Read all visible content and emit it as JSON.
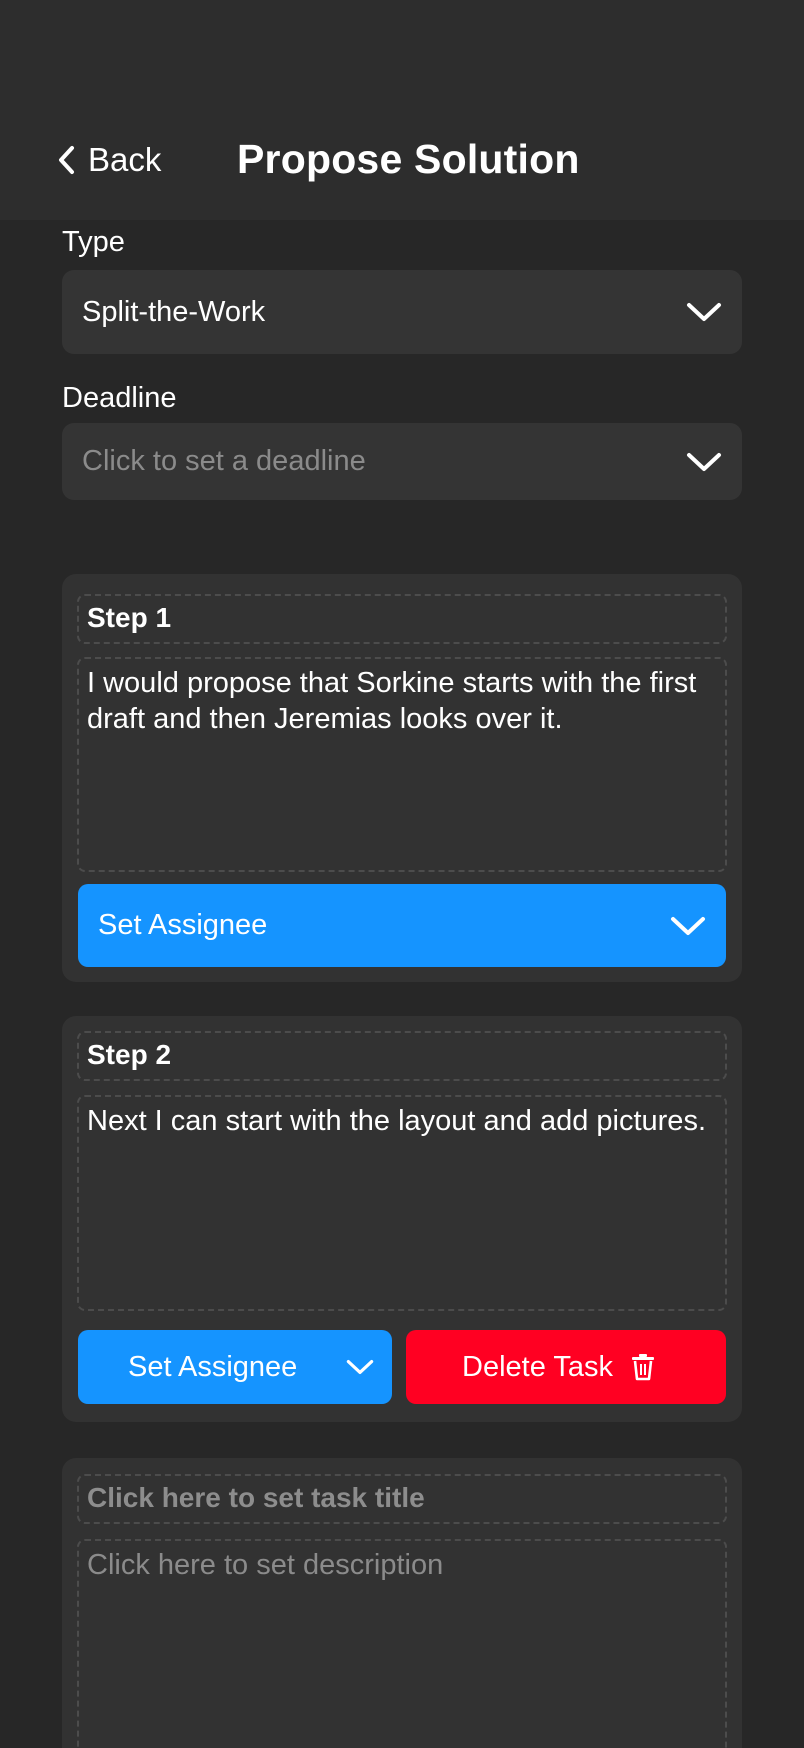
{
  "header": {
    "back_label": "Back",
    "title": "Propose Solution"
  },
  "form": {
    "type_label": "Type",
    "type_value": "Split-the-Work",
    "deadline_label": "Deadline",
    "deadline_placeholder": "Click to set a deadline"
  },
  "steps": [
    {
      "title": "Step 1",
      "description": "I would propose that Sorkine starts with the first draft and then Jeremias looks over it.",
      "assignee_label": "Set Assignee"
    },
    {
      "title": "Step 2",
      "description": "Next I can start with the layout and add pictures.",
      "assignee_label": "Set Assignee",
      "delete_label": "Delete Task"
    }
  ],
  "new_step": {
    "title_placeholder": "Click here to set task title",
    "description_placeholder": "Click here to set description"
  },
  "colors": {
    "background": "#272727",
    "header": "#2d2d2d",
    "card": "#323232",
    "accent_blue": "#1594ff",
    "danger_red": "#ff0022"
  },
  "icons": {
    "back": "chevron-left-icon",
    "dropdown": "chevron-down-icon",
    "delete": "trash-icon"
  }
}
